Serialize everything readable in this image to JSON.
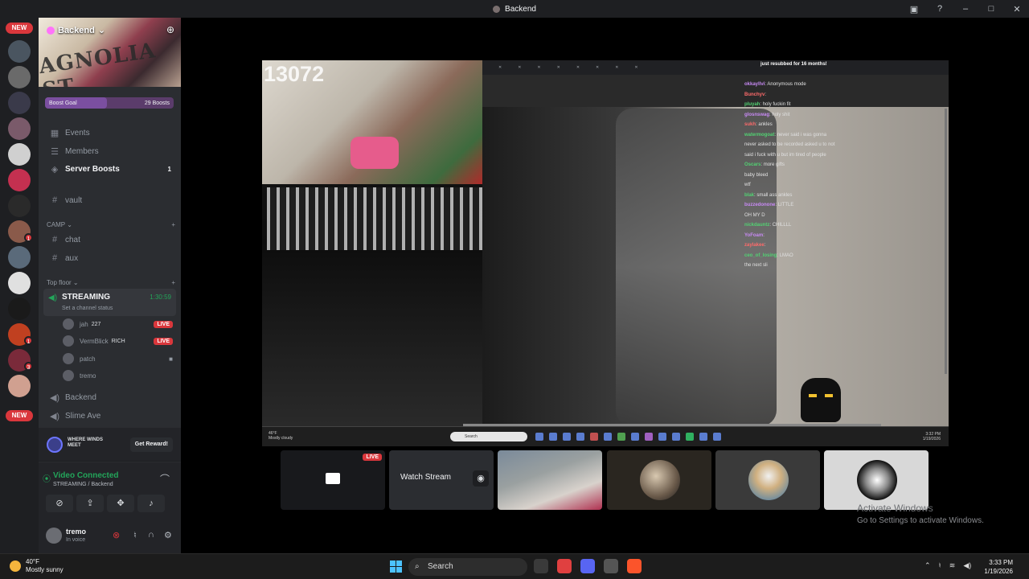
{
  "window": {
    "title": "Backend"
  },
  "server": {
    "name": "Backend",
    "banner_text": "AGNOLIA ST",
    "boost_goal_label": "Boost Goal",
    "boost_count": "29 Boosts",
    "boost_progress": 0.48
  },
  "nav": {
    "events": "Events",
    "members": "Members",
    "server_boosts": "Server Boosts",
    "server_boosts_count": "1"
  },
  "channels": {
    "vault": "vault",
    "camp_category": "CAMP",
    "chat": "chat",
    "aux": "aux",
    "topfloor_category": "Top floor",
    "streaming": "STREAMING",
    "streaming_time": "1:30:59",
    "streaming_status": "Set a channel status",
    "backend": "Backend",
    "slime_ave": "Slime Ave"
  },
  "members": [
    {
      "name": "jah",
      "extra": "227",
      "live": "LIVE"
    },
    {
      "name": "VermBlick",
      "extra": "RICH",
      "live": "LIVE"
    },
    {
      "name": "patch",
      "extra": "",
      "live": ""
    },
    {
      "name": "tremo",
      "extra": "",
      "live": ""
    }
  ],
  "rail": {
    "new_badge": "NEW",
    "pip_counts": [
      "1",
      "1",
      "3"
    ]
  },
  "promo": {
    "text": "WHERE WINDS MEET",
    "button": "Get Reward!"
  },
  "voice": {
    "connected": "Video Connected",
    "location": "STREAMING / Backend"
  },
  "user": {
    "name": "tremo",
    "status": "In voice"
  },
  "stream": {
    "viewer_count": "13072",
    "chat_banner": "just resubbed for 16 months!",
    "chat": [
      {
        "user": "okkayllvi",
        "msg": "Anonymous mode"
      },
      {
        "user": "Bunchyv",
        "msg": ""
      },
      {
        "user": "pluyah",
        "msg": "holy fuckin fit"
      },
      {
        "user": "glosnswag",
        "msg": "holy shit"
      },
      {
        "user": "sukh",
        "msg": "ankles"
      },
      {
        "user": "watermogoat",
        "msg": "never said i was gonna"
      },
      {
        "user": "",
        "msg": "never asked to be recorded asked u to not"
      },
      {
        "user": "",
        "msg": "said i fuck with u but im tired of people"
      },
      {
        "user": "Oscars",
        "msg": "more gifts"
      },
      {
        "user": "",
        "msg": "baby bleed"
      },
      {
        "user": "",
        "msg": "wtf"
      },
      {
        "user": "blak",
        "msg": "small ass ankles"
      },
      {
        "user": "buzzedonone",
        "msg": "LITTLE"
      },
      {
        "user": "",
        "msg": "OH MY D"
      },
      {
        "user": "nickdauntz",
        "msg": "CHILLLL"
      },
      {
        "user": "YoFoam",
        "msg": ""
      },
      {
        "user": "zaylakee",
        "msg": ""
      },
      {
        "user": "ceo_of_losing",
        "msg": "LMAO"
      },
      {
        "user": "",
        "msg": "the next sli"
      }
    ],
    "inner_weather_temp": "46°F",
    "inner_weather_desc": "Mostly cloudy",
    "inner_search": "Search",
    "inner_time": "3:32 PM",
    "inner_date": "1/19/2026"
  },
  "tiles": {
    "live": "LIVE",
    "watch_stream": "Watch Stream"
  },
  "activate": {
    "title": "Activate Windows",
    "subtitle": "Go to Settings to activate Windows."
  },
  "taskbar": {
    "weather_temp": "40°F",
    "weather_desc": "Mostly sunny",
    "search": "Search",
    "time": "3:33 PM",
    "date": "1/19/2026"
  }
}
